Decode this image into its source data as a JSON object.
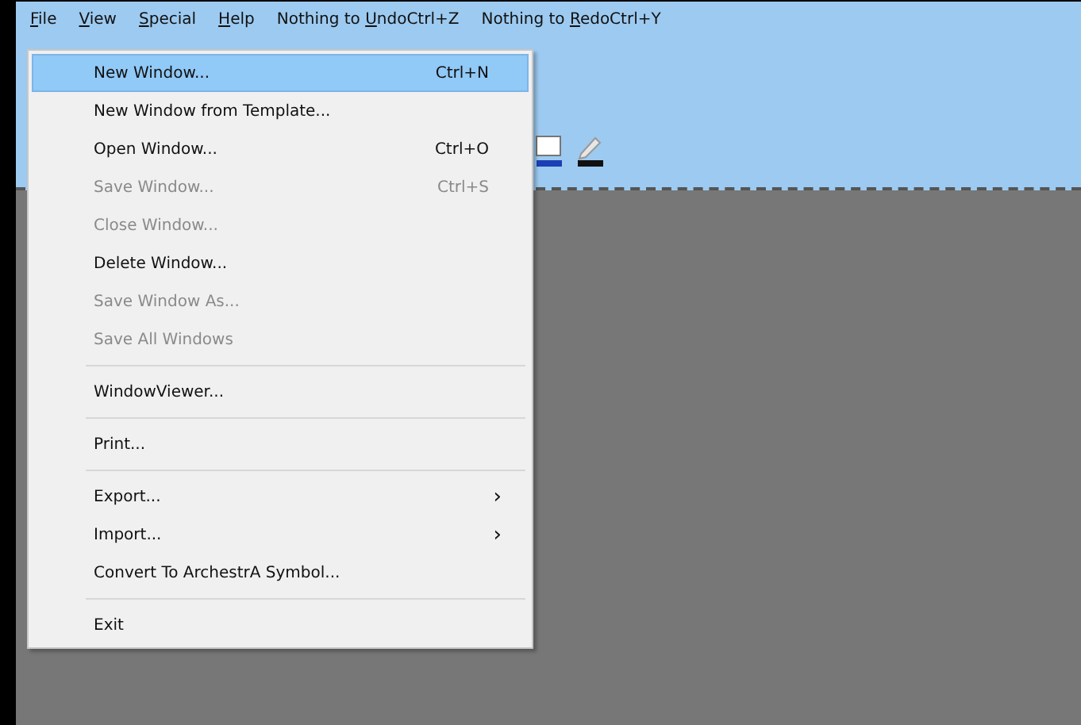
{
  "menu_bar": [
    {
      "key": "F",
      "after": "ile"
    },
    {
      "key": "V",
      "after": "iew"
    },
    {
      "key": "S",
      "after": "pecial"
    },
    {
      "key": "H",
      "after": "elp"
    },
    {
      "before": "Nothing to ",
      "key": "U",
      "after": "ndoCtrl+Z"
    },
    {
      "before": "Nothing to ",
      "key": "R",
      "after": "edoCtrl+Y"
    }
  ],
  "file_menu": [
    {
      "kind": "item",
      "label": "New Window...",
      "shortcut": "Ctrl+N",
      "disabled": false,
      "selected": true
    },
    {
      "kind": "item",
      "label": "New Window from Template...",
      "disabled": false,
      "selected": false
    },
    {
      "kind": "item",
      "label": "Open Window...",
      "shortcut": "Ctrl+O",
      "disabled": false,
      "selected": false
    },
    {
      "kind": "item",
      "label": "Save Window...",
      "shortcut": "Ctrl+S",
      "disabled": true,
      "selected": false
    },
    {
      "kind": "item",
      "label": "Close Window...",
      "disabled": true,
      "selected": false
    },
    {
      "kind": "item",
      "label": "Delete Window...",
      "disabled": false,
      "selected": false
    },
    {
      "kind": "item",
      "label": "Save Window As...",
      "disabled": true,
      "selected": false
    },
    {
      "kind": "item",
      "label": "Save All Windows",
      "disabled": true,
      "selected": false
    },
    {
      "kind": "separator"
    },
    {
      "kind": "item",
      "label": "WindowViewer...",
      "disabled": false,
      "selected": false
    },
    {
      "kind": "separator"
    },
    {
      "kind": "item",
      "label": "Print...",
      "disabled": false,
      "selected": false
    },
    {
      "kind": "separator"
    },
    {
      "kind": "item",
      "label": "Export...",
      "submenu": "›",
      "disabled": false,
      "selected": false
    },
    {
      "kind": "item",
      "label": "Import...",
      "submenu": "›",
      "disabled": false,
      "selected": false
    },
    {
      "kind": "item",
      "label": "Convert To ArchestrA Symbol...",
      "disabled": false,
      "selected": false
    },
    {
      "kind": "separator"
    },
    {
      "kind": "item",
      "label": "Exit",
      "disabled": false,
      "selected": false
    }
  ]
}
